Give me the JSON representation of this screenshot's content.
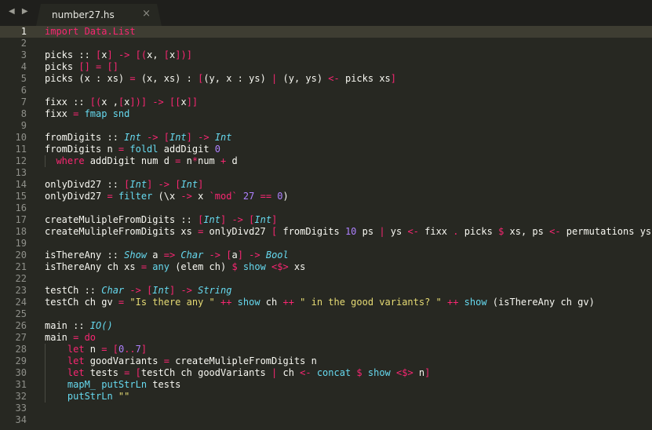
{
  "tab": {
    "title": "number27.hs",
    "close": "×"
  },
  "nav": {
    "back": "◀",
    "forward": "▶"
  },
  "current_line": 1,
  "lines": [
    {
      "n": "1",
      "spans": [
        [
          "import",
          "k"
        ],
        [
          " Data.List",
          "k"
        ]
      ]
    },
    {
      "n": "2",
      "spans": []
    },
    {
      "n": "3",
      "spans": [
        [
          "picks :: ",
          "w"
        ],
        [
          "[",
          "k"
        ],
        [
          "x",
          "w"
        ],
        [
          "]",
          "k"
        ],
        [
          " -> ",
          "k"
        ],
        [
          "[(",
          "k"
        ],
        [
          "x, ",
          "w"
        ],
        [
          "[",
          "k"
        ],
        [
          "x",
          "w"
        ],
        [
          "])]",
          "k"
        ]
      ]
    },
    {
      "n": "4",
      "spans": [
        [
          "picks ",
          "w"
        ],
        [
          "[]",
          "k"
        ],
        [
          " = ",
          "k"
        ],
        [
          "[]",
          "k"
        ]
      ]
    },
    {
      "n": "5",
      "spans": [
        [
          "picks (x : xs) ",
          "w"
        ],
        [
          "=",
          "k"
        ],
        [
          " (x, xs) : ",
          "w"
        ],
        [
          "[",
          "k"
        ],
        [
          "(y, x : ys) ",
          "w"
        ],
        [
          "|",
          "k"
        ],
        [
          " (y, ys) ",
          "w"
        ],
        [
          "<-",
          "k"
        ],
        [
          " picks xs",
          "w"
        ],
        [
          "]",
          "k"
        ]
      ]
    },
    {
      "n": "6",
      "spans": []
    },
    {
      "n": "7",
      "spans": [
        [
          "fixx :: ",
          "w"
        ],
        [
          "[(",
          "k"
        ],
        [
          "x ,",
          "w"
        ],
        [
          "[",
          "k"
        ],
        [
          "x",
          "w"
        ],
        [
          "])]",
          "k"
        ],
        [
          " -> ",
          "k"
        ],
        [
          "[[",
          "k"
        ],
        [
          "x",
          "w"
        ],
        [
          "]]",
          "k"
        ]
      ]
    },
    {
      "n": "8",
      "spans": [
        [
          "fixx ",
          "w"
        ],
        [
          "=",
          "k"
        ],
        [
          " fmap snd",
          "f"
        ]
      ]
    },
    {
      "n": "9",
      "spans": []
    },
    {
      "n": "10",
      "spans": [
        [
          "fromDigits :: ",
          "w"
        ],
        [
          "Int",
          "t"
        ],
        [
          " -> ",
          "k"
        ],
        [
          "[",
          "k"
        ],
        [
          "Int",
          "t"
        ],
        [
          "]",
          "k"
        ],
        [
          " -> ",
          "k"
        ],
        [
          "Int",
          "t"
        ]
      ]
    },
    {
      "n": "11",
      "spans": [
        [
          "fromDigits n ",
          "w"
        ],
        [
          "=",
          "k"
        ],
        [
          " foldl",
          "f"
        ],
        [
          " addDigit ",
          "w"
        ],
        [
          "0",
          "n"
        ]
      ]
    },
    {
      "n": "12",
      "indent": [
        57
      ],
      "spans": [
        [
          "  where",
          "k"
        ],
        [
          " addDigit num d ",
          "w"
        ],
        [
          "=",
          "k"
        ],
        [
          " n",
          "w"
        ],
        [
          "*",
          "k"
        ],
        [
          "num ",
          "w"
        ],
        [
          "+",
          "k"
        ],
        [
          " d",
          "w"
        ]
      ]
    },
    {
      "n": "13",
      "spans": []
    },
    {
      "n": "14",
      "spans": [
        [
          "onlyDivd27 :: ",
          "w"
        ],
        [
          "[",
          "k"
        ],
        [
          "Int",
          "t"
        ],
        [
          "]",
          "k"
        ],
        [
          " -> ",
          "k"
        ],
        [
          "[",
          "k"
        ],
        [
          "Int",
          "t"
        ],
        [
          "]",
          "k"
        ]
      ]
    },
    {
      "n": "15",
      "spans": [
        [
          "onlyDivd27 ",
          "w"
        ],
        [
          "=",
          "k"
        ],
        [
          " filter",
          "f"
        ],
        [
          " (\\x ",
          "w"
        ],
        [
          "->",
          "k"
        ],
        [
          " x ",
          "w"
        ],
        [
          "`mod`",
          "k"
        ],
        [
          " 27",
          "n"
        ],
        [
          " ==",
          "k"
        ],
        [
          " 0",
          "n"
        ],
        [
          ")",
          "w"
        ]
      ]
    },
    {
      "n": "16",
      "spans": []
    },
    {
      "n": "17",
      "spans": [
        [
          "createMulipleFromDigits :: ",
          "w"
        ],
        [
          "[",
          "k"
        ],
        [
          "Int",
          "t"
        ],
        [
          "]",
          "k"
        ],
        [
          " -> ",
          "k"
        ],
        [
          "[",
          "k"
        ],
        [
          "Int",
          "t"
        ],
        [
          "]",
          "k"
        ]
      ]
    },
    {
      "n": "18",
      "spans": [
        [
          "createMulipleFromDigits xs ",
          "w"
        ],
        [
          "=",
          "k"
        ],
        [
          " onlyDivd27 ",
          "w"
        ],
        [
          "[",
          "k"
        ],
        [
          " fromDigits ",
          "w"
        ],
        [
          "10",
          "n"
        ],
        [
          " ps ",
          "w"
        ],
        [
          "|",
          "k"
        ],
        [
          " ys ",
          "w"
        ],
        [
          "<-",
          "k"
        ],
        [
          " fixx ",
          "w"
        ],
        [
          ".",
          "k"
        ],
        [
          " picks ",
          "w"
        ],
        [
          "$",
          "k"
        ],
        [
          " xs, ps ",
          "w"
        ],
        [
          "<-",
          "k"
        ],
        [
          " permutations ys",
          "w"
        ],
        [
          "]",
          "k"
        ]
      ]
    },
    {
      "n": "19",
      "spans": []
    },
    {
      "n": "20",
      "spans": [
        [
          "isThereAny :: ",
          "w"
        ],
        [
          "Show",
          "t"
        ],
        [
          " a ",
          "w"
        ],
        [
          "=>",
          "k"
        ],
        [
          " Char",
          "t"
        ],
        [
          " -> ",
          "k"
        ],
        [
          "[",
          "k"
        ],
        [
          "a",
          "w"
        ],
        [
          "]",
          "k"
        ],
        [
          " -> ",
          "k"
        ],
        [
          "Bool",
          "t"
        ]
      ]
    },
    {
      "n": "21",
      "spans": [
        [
          "isThereAny ch xs ",
          "w"
        ],
        [
          "=",
          "k"
        ],
        [
          " any",
          "f"
        ],
        [
          " (elem ch)",
          "w"
        ],
        [
          " $",
          "k"
        ],
        [
          " show",
          "f"
        ],
        [
          " <$>",
          "k"
        ],
        [
          " xs",
          "w"
        ]
      ]
    },
    {
      "n": "22",
      "spans": []
    },
    {
      "n": "23",
      "spans": [
        [
          "testCh :: ",
          "w"
        ],
        [
          "Char",
          "t"
        ],
        [
          " -> ",
          "k"
        ],
        [
          "[",
          "k"
        ],
        [
          "Int",
          "t"
        ],
        [
          "]",
          "k"
        ],
        [
          " -> ",
          "k"
        ],
        [
          "String",
          "t"
        ]
      ]
    },
    {
      "n": "24",
      "spans": [
        [
          "testCh ch gv ",
          "w"
        ],
        [
          "=",
          "k"
        ],
        [
          " \"Is there any \"",
          "s"
        ],
        [
          " ++",
          "k"
        ],
        [
          " show",
          "f"
        ],
        [
          " ch ",
          "w"
        ],
        [
          "++",
          "k"
        ],
        [
          " \" in the good variants? \"",
          "s"
        ],
        [
          " ++",
          "k"
        ],
        [
          " show",
          "f"
        ],
        [
          " (isThereAny ch gv)",
          "w"
        ]
      ]
    },
    {
      "n": "25",
      "spans": []
    },
    {
      "n": "26",
      "spans": [
        [
          "main :: ",
          "w"
        ],
        [
          "IO()",
          "t"
        ]
      ]
    },
    {
      "n": "27",
      "spans": [
        [
          "main ",
          "w"
        ],
        [
          "=",
          "k"
        ],
        [
          " do",
          "k"
        ]
      ]
    },
    {
      "n": "28",
      "indent": [
        57
      ],
      "spans": [
        [
          "    let",
          "k"
        ],
        [
          " n ",
          "w"
        ],
        [
          "=",
          "k"
        ],
        [
          " [",
          "k"
        ],
        [
          "0",
          "n"
        ],
        [
          "..",
          "k"
        ],
        [
          "7",
          "n"
        ],
        [
          "]",
          "k"
        ]
      ]
    },
    {
      "n": "29",
      "indent": [
        57
      ],
      "spans": [
        [
          "    let",
          "k"
        ],
        [
          " goodVariants ",
          "w"
        ],
        [
          "=",
          "k"
        ],
        [
          " createMulipleFromDigits n",
          "w"
        ]
      ]
    },
    {
      "n": "30",
      "indent": [
        57
      ],
      "spans": [
        [
          "    let",
          "k"
        ],
        [
          " tests ",
          "w"
        ],
        [
          "=",
          "k"
        ],
        [
          " [",
          "k"
        ],
        [
          "testCh ch goodVariants ",
          "w"
        ],
        [
          "|",
          "k"
        ],
        [
          " ch ",
          "w"
        ],
        [
          "<-",
          "k"
        ],
        [
          " concat",
          "f"
        ],
        [
          " $",
          "k"
        ],
        [
          " show",
          "f"
        ],
        [
          " <$>",
          "k"
        ],
        [
          " n",
          "w"
        ],
        [
          "]",
          "k"
        ]
      ]
    },
    {
      "n": "31",
      "indent": [
        57
      ],
      "spans": [
        [
          "    mapM_ putStrLn",
          "f"
        ],
        [
          " tests",
          "w"
        ]
      ]
    },
    {
      "n": "32",
      "indent": [
        57
      ],
      "spans": [
        [
          "    putStrLn",
          "f"
        ],
        [
          " \"\"",
          "s"
        ]
      ]
    },
    {
      "n": "33",
      "spans": []
    },
    {
      "n": "34",
      "spans": []
    }
  ]
}
